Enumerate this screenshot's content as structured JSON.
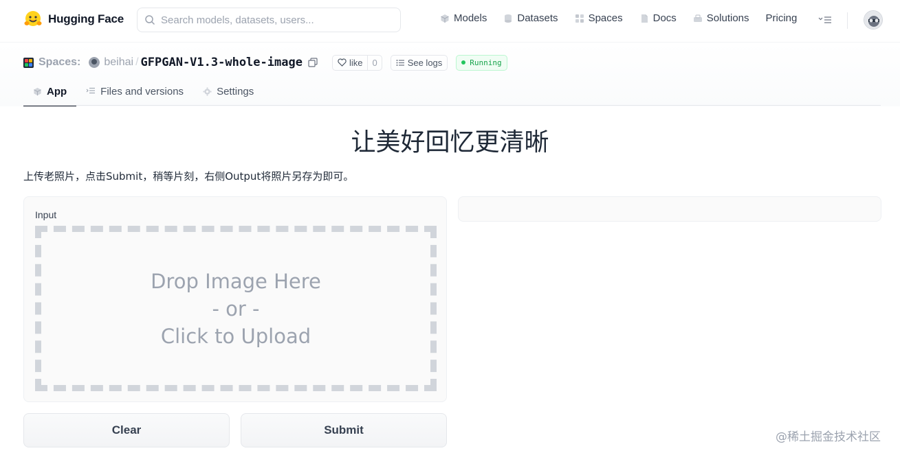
{
  "nav": {
    "brand": "Hugging Face",
    "search_placeholder": "Search models, datasets, users...",
    "links": [
      {
        "label": "Models",
        "icon": "models-icon"
      },
      {
        "label": "Datasets",
        "icon": "datasets-icon"
      },
      {
        "label": "Spaces",
        "icon": "spaces-icon"
      },
      {
        "label": "Docs",
        "icon": "docs-icon"
      },
      {
        "label": "Solutions",
        "icon": "solutions-icon"
      },
      {
        "label": "Pricing",
        "icon": ""
      }
    ]
  },
  "space": {
    "section_label": "Spaces:",
    "owner": "beihai",
    "separator": "/",
    "name": "GFPGAN-V1.3-whole-image",
    "like_label": "like",
    "like_count": "0",
    "logs_label": "See logs",
    "status": "Running"
  },
  "tabs": [
    {
      "label": "App",
      "active": true
    },
    {
      "label": "Files and versions",
      "active": false
    },
    {
      "label": "Settings",
      "active": false
    }
  ],
  "app": {
    "title": "让美好回忆更清晰",
    "description": "上传老照片，点击Submit，稍等片刻，右侧Output将照片另存为即可。",
    "input_label": "Input",
    "dropzone": {
      "line1": "Drop Image Here",
      "line2": "- or -",
      "line3": "Click to Upload"
    },
    "clear_label": "Clear",
    "submit_label": "Submit"
  },
  "watermark": "@稀土掘金技术社区",
  "colors": {
    "status_green": "#16a34a",
    "dropzone_border": "#d1d5db",
    "text_dark": "#111827"
  }
}
